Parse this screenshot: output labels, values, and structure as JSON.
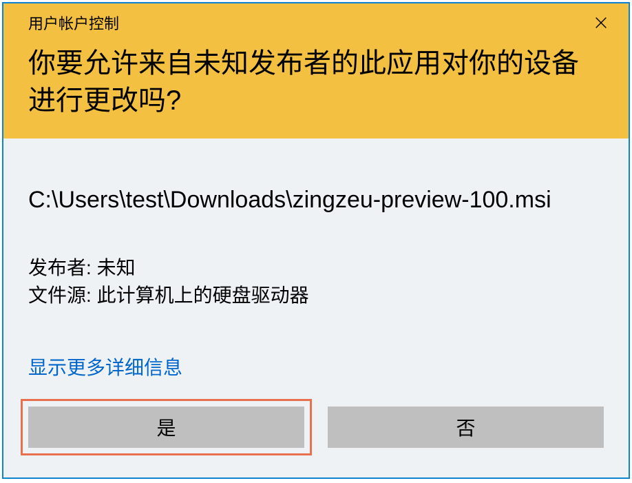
{
  "title": "用户帐户控制",
  "prompt": "你要允许来自未知发布者的此应用对你的设备进行更改吗?",
  "filepath": "C:\\Users\\test\\Downloads\\zingzeu-preview-100.msi",
  "publisher": {
    "label": "发布者",
    "value": "未知"
  },
  "file_source": {
    "label": "文件源",
    "value": "此计算机上的硬盘驱动器"
  },
  "details_link": "显示更多详细信息",
  "buttons": {
    "yes": "是",
    "no": "否"
  }
}
